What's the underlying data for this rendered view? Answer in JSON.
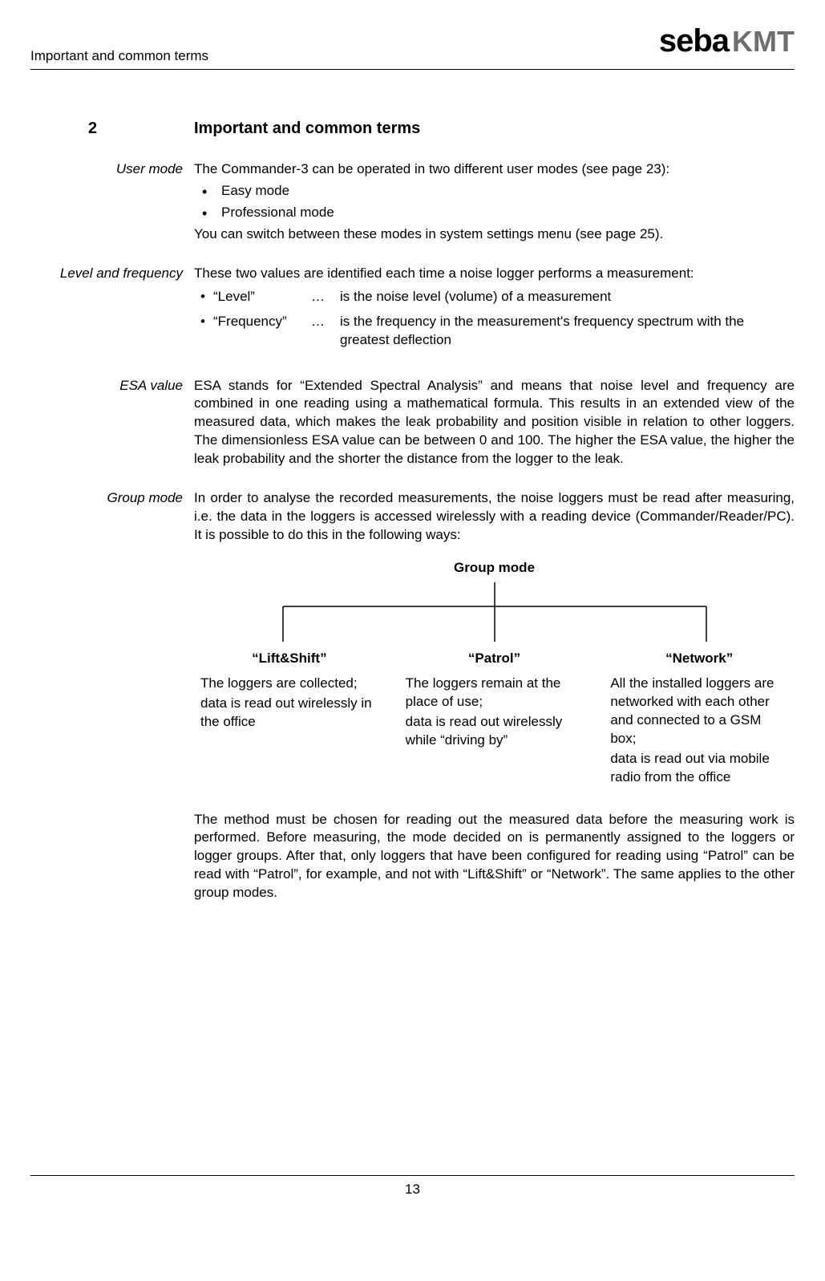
{
  "header": {
    "title": "Important and common terms",
    "logo_seba": "seba",
    "logo_kmt": "KMT"
  },
  "section": {
    "number": "2",
    "title": "Important and common terms"
  },
  "user_mode": {
    "label": "User mode",
    "intro": "The Commander-3 can be operated in two different user modes (see page 23):",
    "items": [
      "Easy mode",
      "Professional mode"
    ],
    "outro": "You can switch between these modes in system settings menu (see page 25)."
  },
  "level_freq": {
    "label": "Level and frequency",
    "intro": "These two values are identified each time a noise logger performs a measurement:",
    "defs": [
      {
        "term": "“Level”",
        "dots": "…",
        "desc": "is the noise level (volume) of a measurement"
      },
      {
        "term": "“Frequency”",
        "dots": "…",
        "desc": "is the frequency in the measurement's frequency spectrum with the greatest deflection"
      }
    ]
  },
  "esa": {
    "label": "ESA value",
    "text": "ESA stands for “Extended Spectral Analysis” and means that noise level and frequency are combined in one reading using a mathematical formula. This results in an extended view of the measured data, which makes the leak probability and position visible in relation to other loggers. The dimensionless ESA value can be between 0 and 100. The higher the ESA value, the higher the leak probability and the shorter the distance from the logger to the leak."
  },
  "group_mode": {
    "label": "Group mode",
    "intro": "In order to analyse the recorded measurements, the noise loggers must be read after measuring, i.e. the data in the loggers is accessed wirelessly with a reading device (Commander/Reader/PC). It is possible to do this in the following ways:",
    "tree_title": "Group mode",
    "cols": [
      {
        "title": "“Lift&Shift”",
        "p1": "The loggers are collected;",
        "p2": "data is read out wirelessly in the office"
      },
      {
        "title": "“Patrol”",
        "p1": "The loggers remain at the place of use;",
        "p2": "data is read out wirelessly while “driving by”"
      },
      {
        "title": "“Network”",
        "p1": "All the installed loggers are networked with each other and connected to a GSM box;",
        "p2": "data is read out via mobile radio from the office"
      }
    ],
    "outro": "The method must be chosen for reading out the measured data before the measuring work is performed. Before measuring, the mode decided on is permanently assigned to the loggers or logger groups. After that, only loggers that have been configured for reading using “Patrol” can be read with “Patrol”, for example, and not with “Lift&Shift” or “Network”. The same applies to the other group modes."
  },
  "footer": {
    "page_number": "13"
  }
}
